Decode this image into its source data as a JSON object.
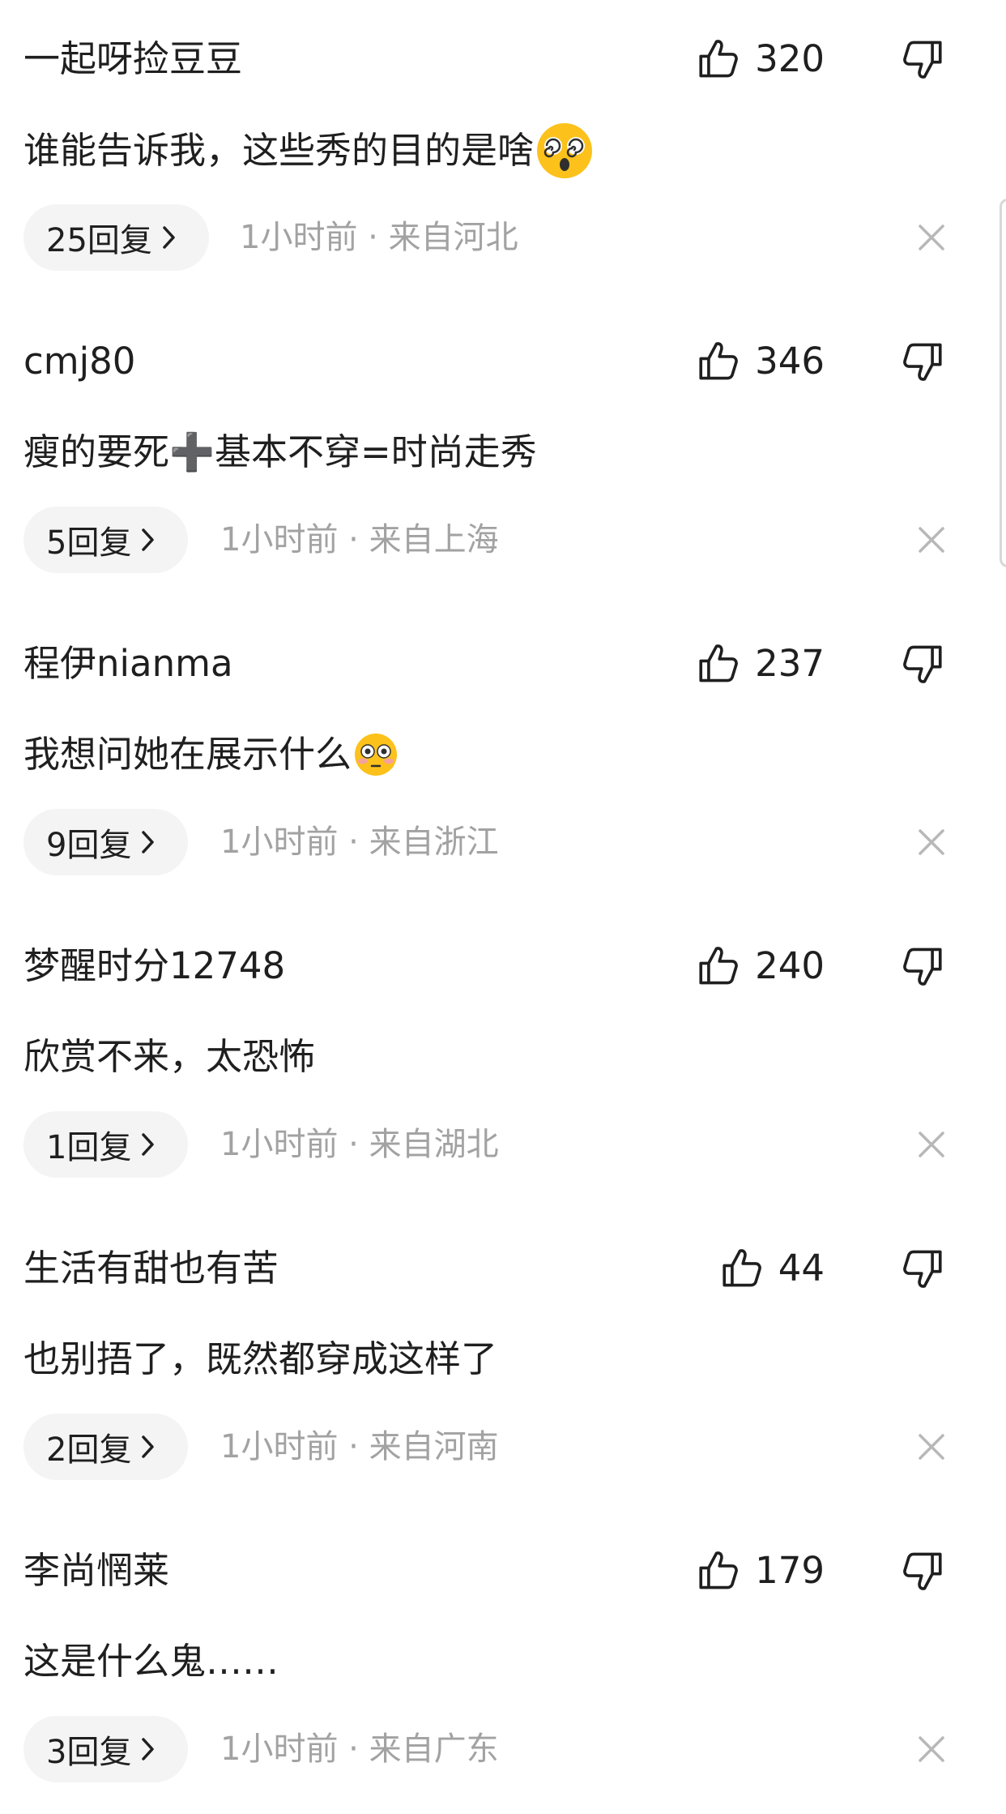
{
  "comments": [
    {
      "username": "一起呀捡豆豆",
      "likes": "320",
      "text": "谁能告诉我，这些秀的目的是啥",
      "emoji": "dizzy-face-emoji",
      "replies": "25回复",
      "time": "1小时前",
      "location": "来自河北"
    },
    {
      "username": "cmj80",
      "likes": "346",
      "text": "瘦的要死➕基本不穿=时尚走秀",
      "emoji": "",
      "replies": "5回复",
      "time": "1小时前",
      "location": "来自上海"
    },
    {
      "username": "程伊nianma",
      "likes": "237",
      "text": "我想问她在展示什么",
      "emoji": "flushed-face-emoji",
      "replies": "9回复",
      "time": "1小时前",
      "location": "来自浙江"
    },
    {
      "username": "梦醒时分12748",
      "likes": "240",
      "text": "欣赏不来，太恐怖",
      "emoji": "",
      "replies": "1回复",
      "time": "1小时前",
      "location": "来自湖北"
    },
    {
      "username": "生活有甜也有苦",
      "likes": "44",
      "text": "也别捂了，既然都穿成这样了",
      "emoji": "",
      "replies": "2回复",
      "time": "1小时前",
      "location": "来自河南"
    },
    {
      "username": "李尚惘莱",
      "likes": "179",
      "text": "这是什么鬼……",
      "emoji": "",
      "replies": "3回复",
      "time": "1小时前",
      "location": "来自广东"
    }
  ],
  "meta_separator": " · ",
  "icons": {
    "like": "thumbs-up-icon",
    "dislike": "thumbs-down-icon",
    "reply_arrow": "chevron-right-icon",
    "dismiss": "close-icon"
  },
  "colors": {
    "text": "#1f1f1f",
    "meta": "#a2a2a2",
    "pill_bg": "#f4f4f4",
    "close": "#b8b8b8"
  }
}
